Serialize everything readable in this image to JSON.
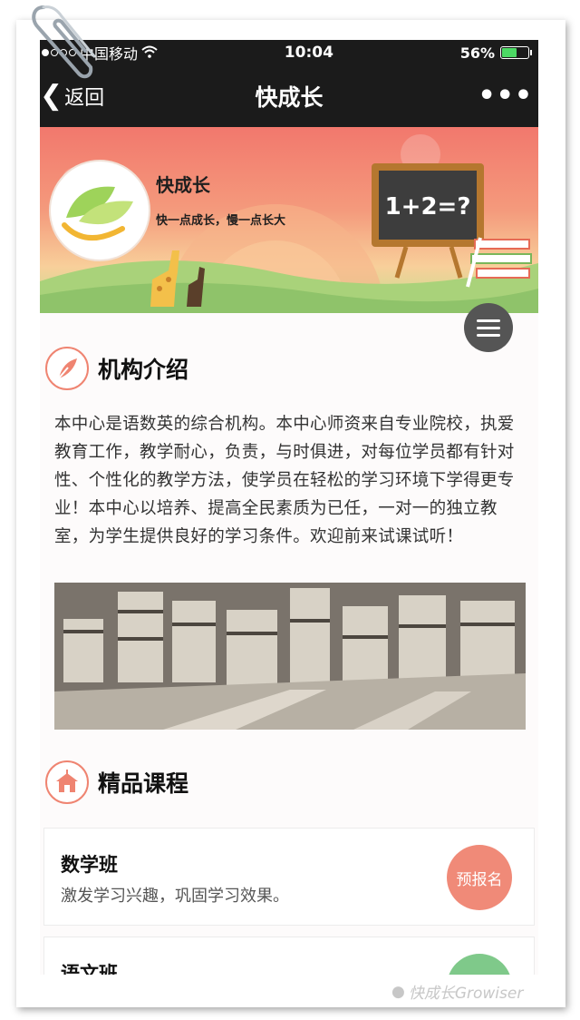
{
  "status_bar": {
    "carrier": "中国移动",
    "time": "10:04",
    "battery": "56%",
    "battery_level": 0.56
  },
  "nav": {
    "back_label": "返回",
    "title": "快成长",
    "more_icon": "more-dots-icon"
  },
  "banner": {
    "name": "快成长",
    "slogan": "快一点成长，慢一点长大",
    "board_text": "1+2=?"
  },
  "intro": {
    "title": "机构介绍",
    "icon": "feather-icon",
    "text": "本中心是语数英的综合机构。本中心师资来自专业院校，执爱教育工作，教学耐心，负责，与时俱进，对每位学员都有针对性、个性化的教学方法，使学员在轻松的学习环境下学得更专业！本中心以培养、提高全民素质为已任，一对一的独立教室，为学生提供良好的学习条件。欢迎前来试课试听！"
  },
  "courses": {
    "title": "精品课程",
    "icon": "school-icon",
    "items": [
      {
        "name": "数学班",
        "desc": "激发学习兴趣，巩固学习效果。",
        "button": "预报名"
      },
      {
        "name": "语文班",
        "desc": "",
        "button": ""
      }
    ]
  },
  "watermark": "快成长Growiser",
  "colors": {
    "accent": "#f08a78",
    "navbar": "#1b1b1b",
    "green": "#7fc98a"
  }
}
